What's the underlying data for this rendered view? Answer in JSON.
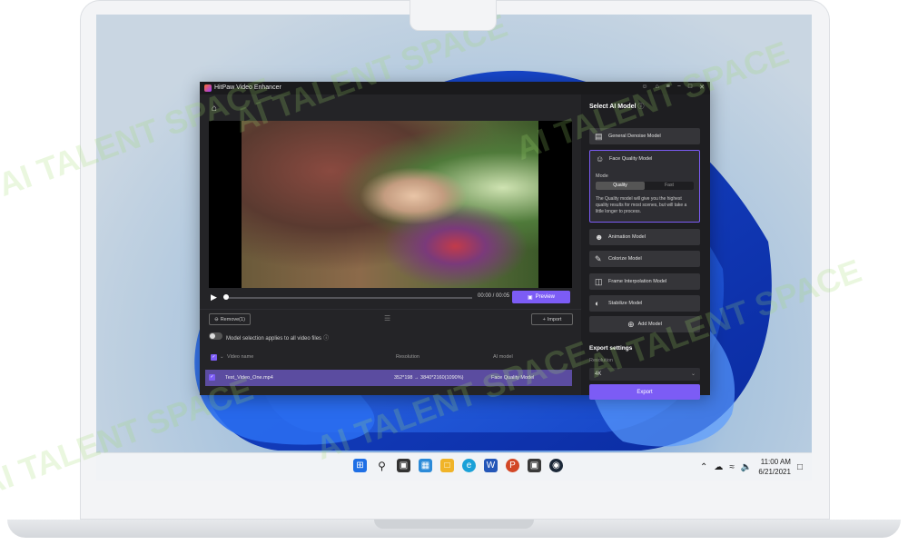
{
  "app": {
    "title": "HitPaw Video Enhancer",
    "window_controls": [
      "☺",
      "⌂",
      "≡",
      "−",
      "□",
      "✕"
    ]
  },
  "player": {
    "time": "00:00 / 00:05",
    "preview_label": "Preview"
  },
  "file_list": {
    "remove_label": "Remove(1)",
    "import_label": "Import",
    "toggle_label": "Model selection applies to all video files",
    "headers": {
      "name": "Video name",
      "resolution": "Resolution",
      "model": "AI model"
    },
    "rows": [
      {
        "name": "Test_Video_One.mp4",
        "resolution": "352*198  →  3840*2160(1090%)",
        "model": "Face Quality Model"
      }
    ]
  },
  "ai_model": {
    "title": "Select AI Model",
    "models": [
      {
        "label": "General Denoise Model",
        "icon": "denoise-icon"
      },
      {
        "label": "Face Quality Model",
        "icon": "face-icon"
      },
      {
        "label": "Animation Model",
        "icon": "animation-icon"
      },
      {
        "label": "Colorize Model",
        "icon": "colorize-icon"
      },
      {
        "label": "Frame Interpolation Model",
        "icon": "frame-icon"
      },
      {
        "label": "Stabilize Model",
        "icon": "stabilize-icon"
      }
    ],
    "mode_label": "Mode",
    "mode_options": [
      "Quality",
      "Fast"
    ],
    "mode_selected": "Quality",
    "face_description": "The Quality model will give you the highest quality results for most scenes, but will take a little longer to process.",
    "add_model_label": "Add Model"
  },
  "export": {
    "title": "Export settings",
    "resolution_label": "Resolution",
    "resolution_value": "4K",
    "export_label": "Export"
  },
  "taskbar": {
    "time": "11:00 AM",
    "date": "6/21/2021"
  },
  "watermark": "AI TALENT SPACE",
  "colors": {
    "accent": "#7c5cf5",
    "app_bg": "#1e1e21",
    "selected_row": "#5b4ca0"
  }
}
